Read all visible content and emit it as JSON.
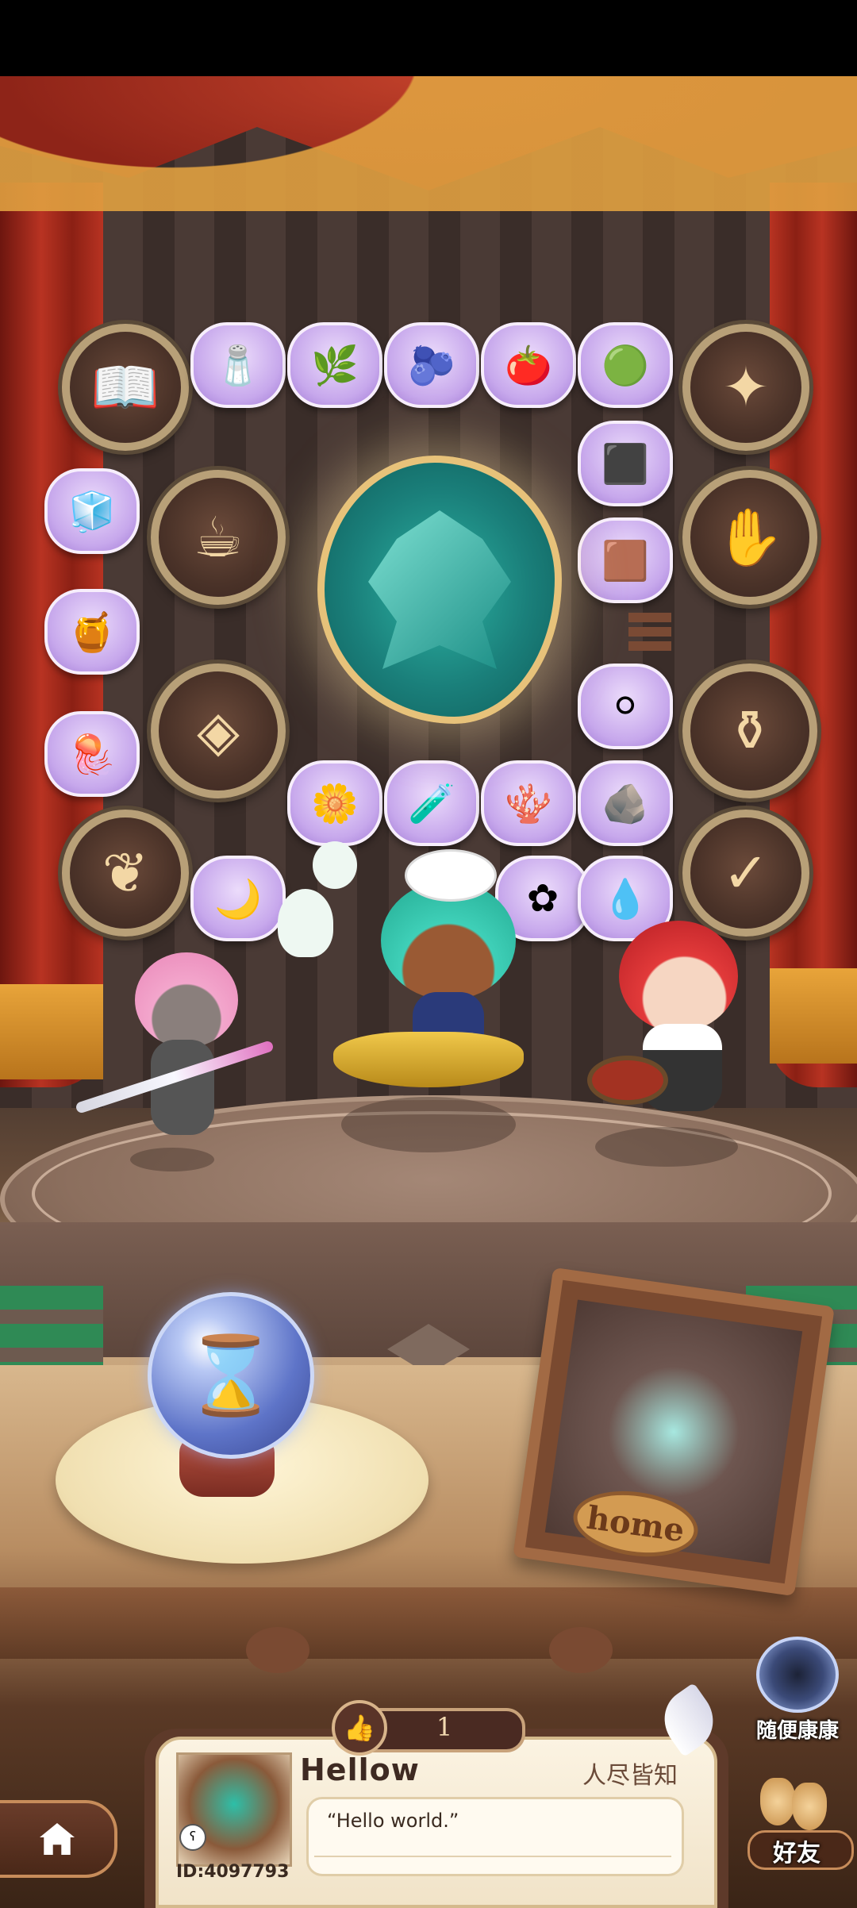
{
  "top_medals": [
    {
      "name": "book-medal-icon",
      "glyph": "📖"
    },
    {
      "name": "fairy-medal-icon",
      "glyph": "✦"
    },
    {
      "name": "cauldron-medal-icon",
      "glyph": "☕"
    },
    {
      "name": "hand-cup-medal-icon",
      "glyph": "✋"
    },
    {
      "name": "mask-medal-icon",
      "glyph": "◈"
    },
    {
      "name": "pot-medal-icon",
      "glyph": "⚱"
    },
    {
      "name": "sprout-medal-icon",
      "glyph": "❦"
    },
    {
      "name": "scroll-medal-icon",
      "glyph": "✓"
    }
  ],
  "ingredient_chips": [
    {
      "name": "salt-chip-icon",
      "glyph": "🧂"
    },
    {
      "name": "herb-chip-icon",
      "glyph": "🌿"
    },
    {
      "name": "blueberry-chip-icon",
      "glyph": "🫐"
    },
    {
      "name": "tomato-chip-icon",
      "glyph": "🍅"
    },
    {
      "name": "jade-chip-icon",
      "glyph": "🟢"
    },
    {
      "name": "charcoal-chip-icon",
      "glyph": "⬛"
    },
    {
      "name": "sugar-cube-chip-icon",
      "glyph": "🧊"
    },
    {
      "name": "chocolate-chip-icon",
      "glyph": "🟫"
    },
    {
      "name": "honeycomb-chip-icon",
      "glyph": "🍯"
    },
    {
      "name": "pearl-chip-icon",
      "glyph": "⚪"
    },
    {
      "name": "jellyfish-chip-icon",
      "glyph": "🪼"
    },
    {
      "name": "flower-chip-icon",
      "glyph": "🌼"
    },
    {
      "name": "potion-chip-icon",
      "glyph": "🧪"
    },
    {
      "name": "coral-chip-icon",
      "glyph": "🪸"
    },
    {
      "name": "ore-chip-icon",
      "glyph": "🪨"
    },
    {
      "name": "moon-chip-icon",
      "glyph": "🌙"
    },
    {
      "name": "blossom-chip-icon",
      "glyph": "✿"
    },
    {
      "name": "water-chip-icon",
      "glyph": "💧"
    }
  ],
  "home_badge_label": "home",
  "random_visit_label": "随便康康",
  "likes": {
    "count": "1"
  },
  "profile": {
    "name": "Hellow",
    "title": "人尽皆知",
    "message": "“Hello world.”",
    "id": "ID:4097793"
  },
  "friends_label": "好友"
}
